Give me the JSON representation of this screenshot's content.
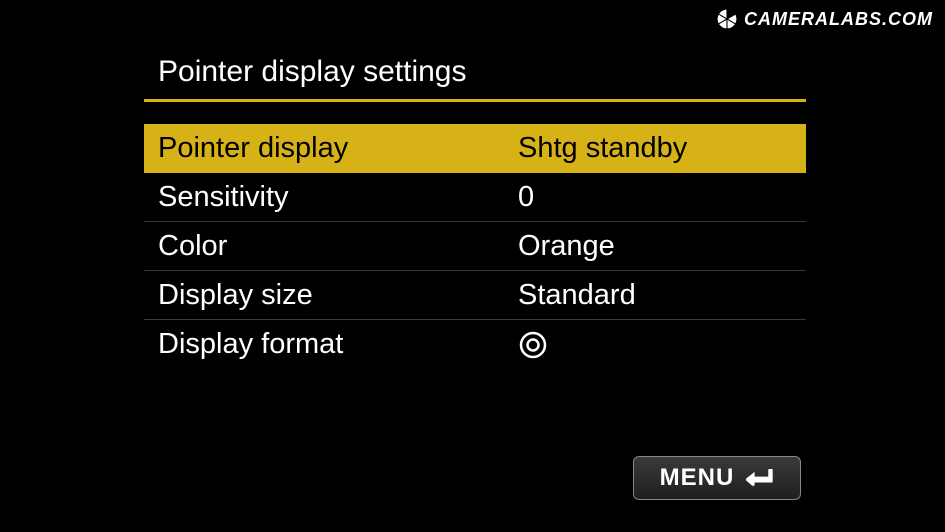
{
  "watermark": {
    "text": "CAMERALABS.COM"
  },
  "title": "Pointer display settings",
  "menu": {
    "items": [
      {
        "label": "Pointer display",
        "value": "Shtg standby",
        "selected": true
      },
      {
        "label": "Sensitivity",
        "value": "0"
      },
      {
        "label": "Color",
        "value": "Orange"
      },
      {
        "label": "Display size",
        "value": "Standard"
      },
      {
        "label": "Display format",
        "value_icon": "concentric-circles"
      }
    ]
  },
  "footer": {
    "menu_label": "MENU"
  }
}
